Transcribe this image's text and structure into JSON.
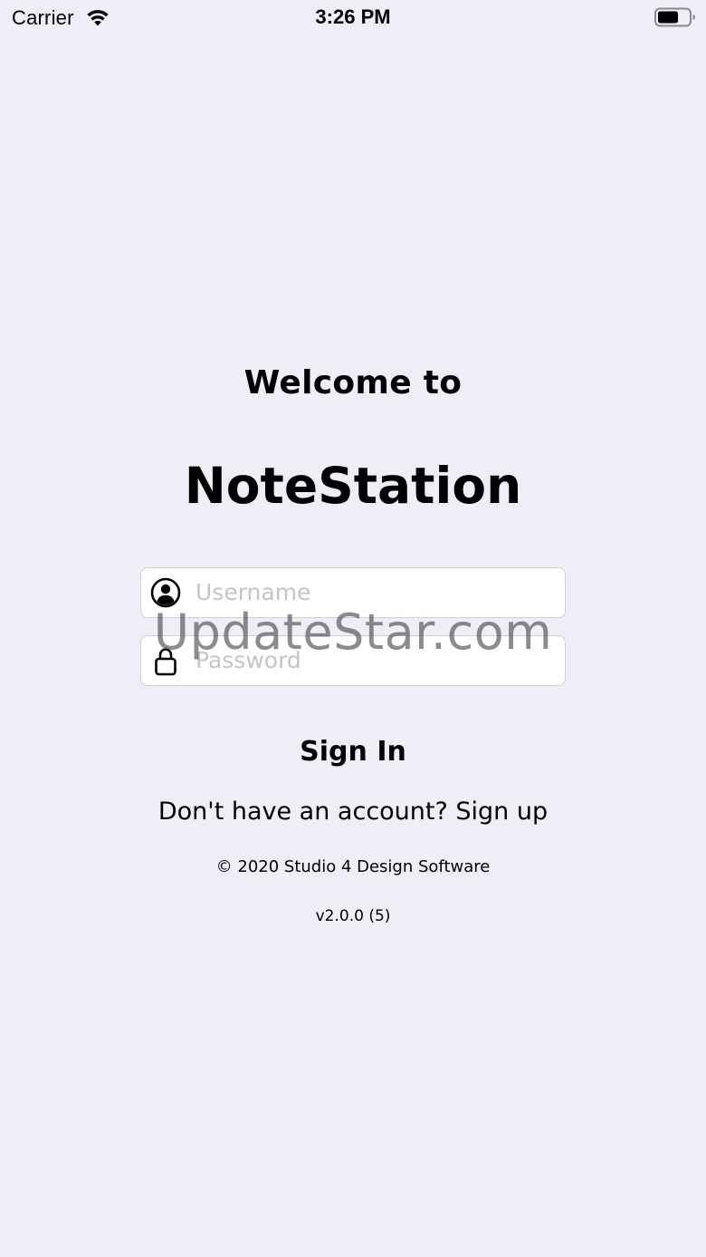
{
  "status_bar": {
    "carrier": "Carrier",
    "time": "3:26 PM",
    "icons": [
      "wifi-icon",
      "battery-icon"
    ]
  },
  "login": {
    "welcome_text": "Welcome to",
    "app_name": "NoteStation",
    "username": {
      "placeholder": "Username",
      "value": "",
      "icon": "person-circle-icon"
    },
    "password": {
      "placeholder": "Password",
      "value": "",
      "icon": "lock-icon"
    },
    "sign_in_label": "Sign In",
    "sign_up_text": "Don't have an account? Sign up",
    "copyright": "© 2020 Studio 4 Design Software",
    "version": "v2.0.0 (5)"
  },
  "watermark": "UpdateStar.com",
  "colors": {
    "background": "#eeeef6",
    "field_background": "#ffffff",
    "field_border": "#cfcfd4",
    "placeholder": "#c4c4c9",
    "text": "#000000"
  }
}
